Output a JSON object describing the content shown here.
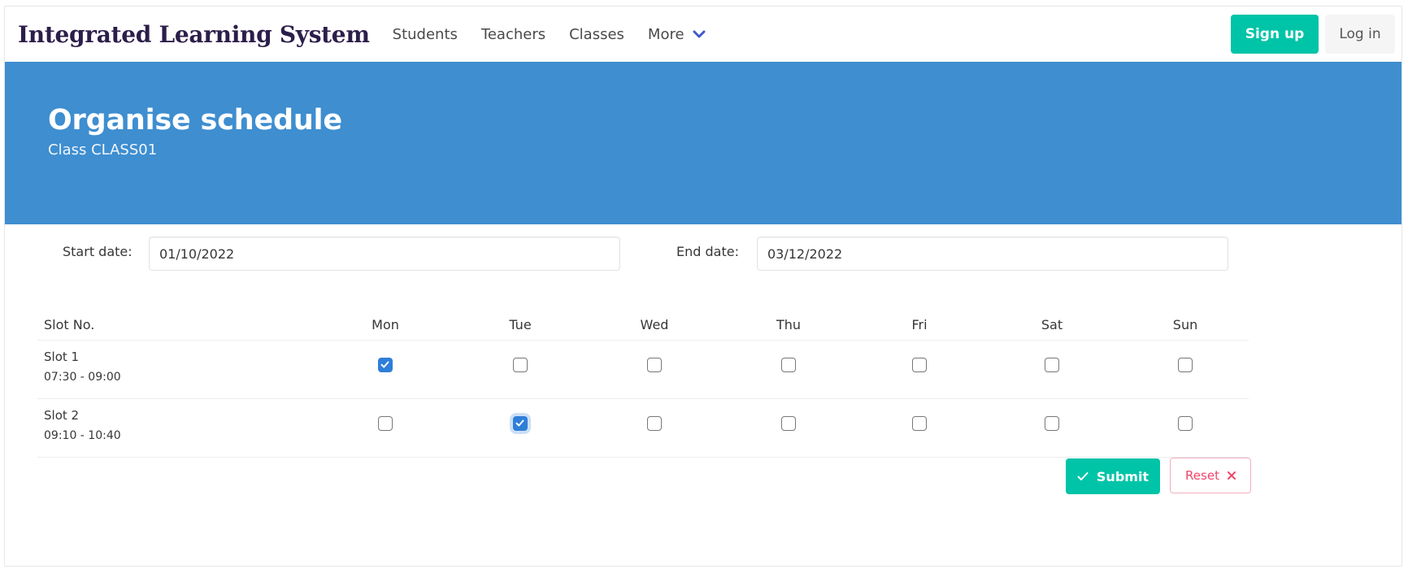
{
  "navbar": {
    "brand": "Integrated Learning System",
    "items": [
      "Students",
      "Teachers",
      "Classes"
    ],
    "more_label": "More",
    "signup_label": "Sign up",
    "login_label": "Log in"
  },
  "hero": {
    "title": "Organise schedule",
    "subtitle": "Class CLASS01"
  },
  "form": {
    "start_label": "Start date:",
    "start_value": "01/10/2022",
    "end_label": "End date:",
    "end_value": "03/12/2022"
  },
  "table": {
    "slot_header": "Slot No.",
    "days": [
      "Mon",
      "Tue",
      "Wed",
      "Thu",
      "Fri",
      "Sat",
      "Sun"
    ],
    "rows": [
      {
        "name": "Slot 1",
        "time": "07:30 - 09:00",
        "checked": [
          true,
          false,
          false,
          false,
          false,
          false,
          false
        ]
      },
      {
        "name": "Slot 2",
        "time": "09:10 - 10:40",
        "checked": [
          false,
          true,
          false,
          false,
          false,
          false,
          false
        ]
      }
    ]
  },
  "actions": {
    "submit_label": "Submit",
    "reset_label": "Reset"
  },
  "colors": {
    "hero": "#3e8ed0",
    "primary": "#00c4a7",
    "danger": "#f14668",
    "checkbox": "#2f7ed8"
  }
}
